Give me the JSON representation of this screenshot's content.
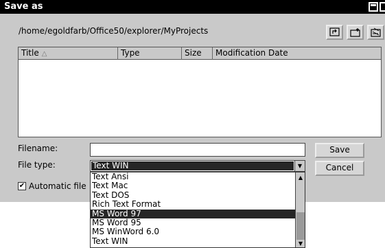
{
  "window": {
    "title": "Save as"
  },
  "path": "/home/egoldfarb/Office50/explorer/MyProjects",
  "list": {
    "columns": [
      "Title",
      "Type",
      "Size",
      "Modification Date"
    ],
    "sort_indicator": "△"
  },
  "form": {
    "filename_label": "Filename:",
    "filename_value": "",
    "filetype_label": "File type:",
    "filetype_value": "Text WIN",
    "auto_ext_label": "Automatic file"
  },
  "buttons": {
    "save": "Save",
    "cancel": "Cancel"
  },
  "dropdown": {
    "options": [
      "Text Ansi",
      "Text Mac",
      "Text DOS",
      "Rich Text Format",
      "MS Word 97",
      "MS Word 95",
      "MS WinWord 6.0",
      "Text WIN"
    ],
    "selected": "MS Word 97"
  }
}
